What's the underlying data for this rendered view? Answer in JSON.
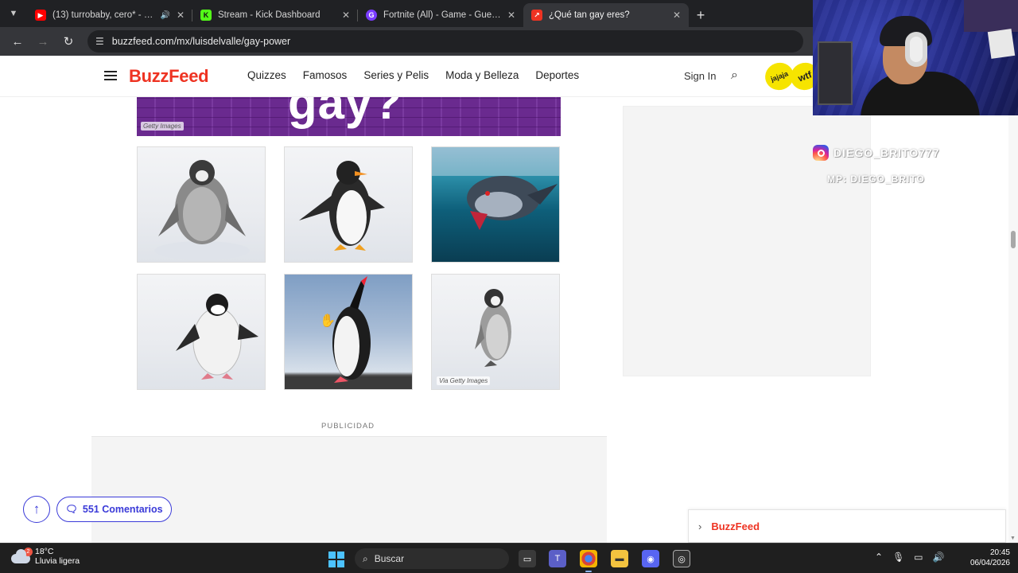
{
  "browser": {
    "tabs": [
      {
        "title": "(13) turrobaby, cero* - Cod",
        "favicon": "youtube-icon",
        "color": "#ff0000",
        "muted_icon": "speaker-icon"
      },
      {
        "title": "Stream - Kick Dashboard",
        "favicon": "kick-icon",
        "color": "#53fc18"
      },
      {
        "title": "Fortnite (All) - Game - Guessr",
        "favicon": "guessr-icon",
        "color": "#7a3cff"
      },
      {
        "title": "¿Qué tan gay eres?",
        "favicon": "buzzfeed-trend-icon",
        "color": "#e32",
        "active": true
      }
    ],
    "url": "buzzfeed.com/mx/luisdelvalle/gay-power"
  },
  "site": {
    "logo": "BuzzFeed",
    "nav": [
      "Quizzes",
      "Famosos",
      "Series y Pelis",
      "Moda y Belleza",
      "Deportes"
    ],
    "sign_in": "Sign In",
    "badges": [
      "jajaja",
      "wtf"
    ]
  },
  "quiz": {
    "hero_text": "gay?",
    "hero_credit": "Getty Images",
    "options": [
      {
        "label": "penguin-chick-walking",
        "bg": "snow"
      },
      {
        "label": "gentoo-penguin-dancing",
        "bg": "snow"
      },
      {
        "label": "penguin-underwater",
        "bg": "water"
      },
      {
        "label": "chinstrap-penguin",
        "bg": "snow"
      },
      {
        "label": "penguin-looking-up",
        "bg": "sky"
      },
      {
        "label": "emperor-penguin-chick",
        "bg": "snow",
        "credit": "Via Getty Images"
      }
    ]
  },
  "ad_label": "PUBLICIDAD",
  "comments_label": "551 Comentarios",
  "bottom_panel": "BuzzFeed",
  "overlay": {
    "handle": "DIEGO_BRITO777",
    "sub": "MP: DIEGO_BRITO"
  },
  "taskbar": {
    "weather_temp": "18°C",
    "weather_desc": "Lluvia ligera",
    "weather_badge": "2",
    "search_placeholder": "Buscar",
    "time": "20:45",
    "date": "06/04/2026"
  }
}
